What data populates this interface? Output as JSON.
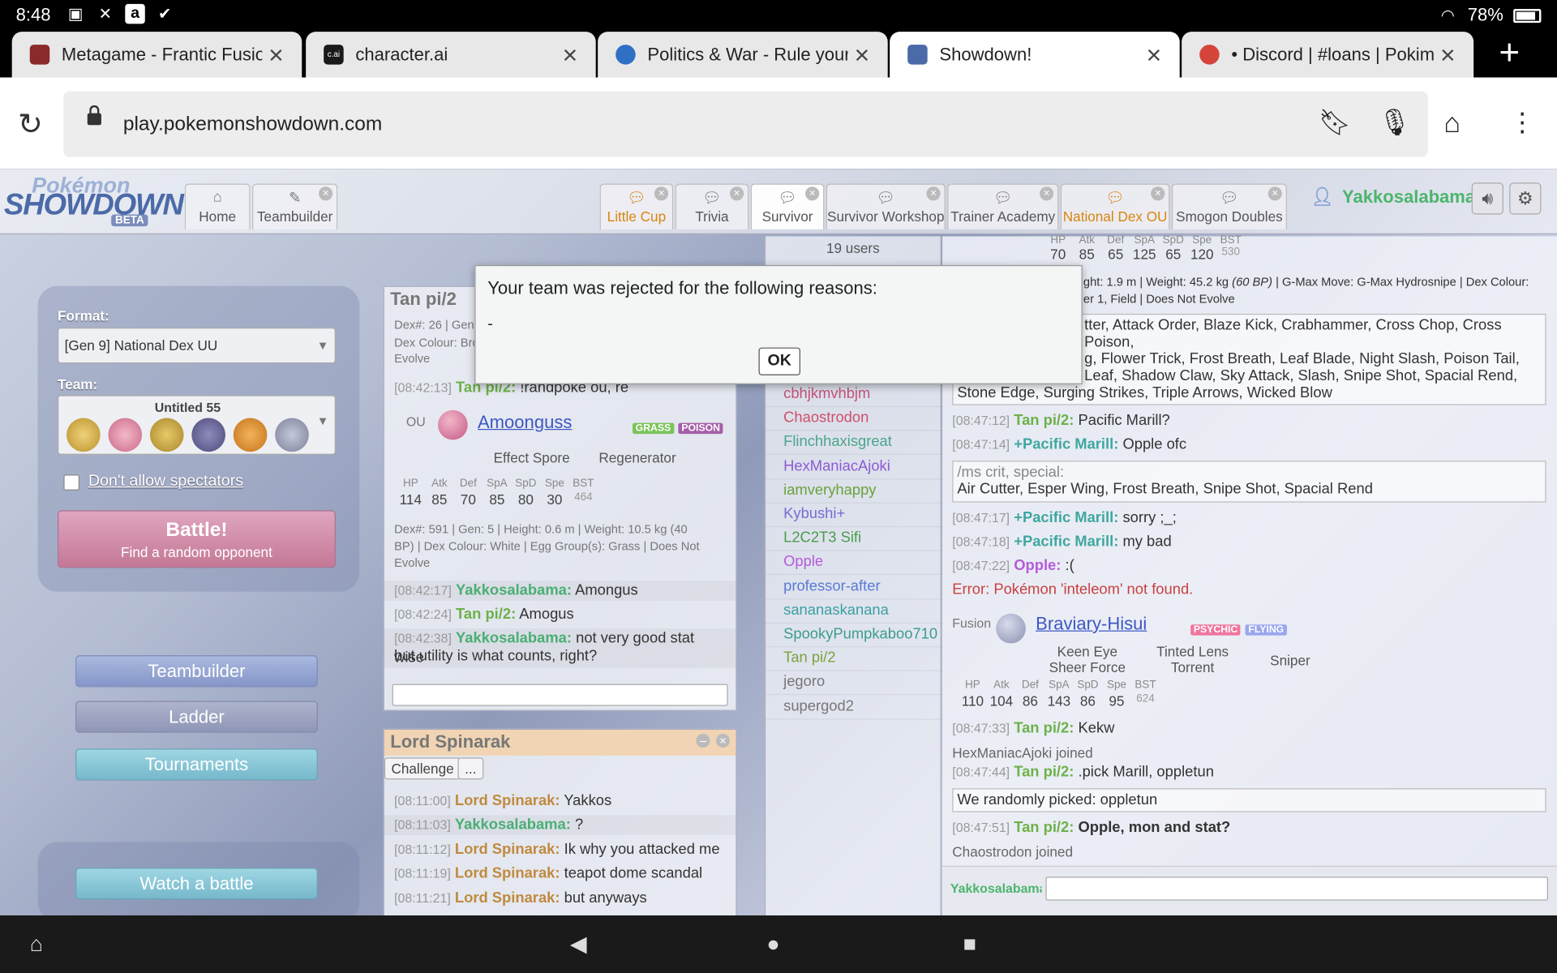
{
  "status": {
    "time": "8:48",
    "battery": "78%",
    "icons": [
      "image-icon",
      "x-icon",
      "amazon-icon",
      "check-icon"
    ]
  },
  "browser": {
    "tabs": [
      {
        "title": "Metagame - Frantic Fusions",
        "favicon_color": "#8b2a2a"
      },
      {
        "title": "character.ai",
        "favicon_color": "#1a1a1a",
        "favicon_text": "c.ai"
      },
      {
        "title": "Politics & War - Rule your ow",
        "favicon_color": "#2f6fc4"
      },
      {
        "title": "Showdown!",
        "favicon_color": "#4b6aa8",
        "active": true
      },
      {
        "title": "• Discord | #loans | Pokimans",
        "favicon_color": "#d4443a"
      }
    ],
    "url": "play.pokemonshowdown.com"
  },
  "header": {
    "logo_top": "Pokémon",
    "logo_main": "SHOWDOWN",
    "logo_beta": "BETA",
    "home": "Home",
    "teambuilder": "Teambuilder",
    "rooms": [
      {
        "label": "Little Cup",
        "highlight": true
      },
      {
        "label": "Trivia"
      },
      {
        "label": "Survivor"
      },
      {
        "label": "Survivor Workshop"
      },
      {
        "label": "Trainer Academy"
      },
      {
        "label": "National Dex OU",
        "highlight": true
      },
      {
        "label": "Smogon Doubles"
      }
    ],
    "username": "Yakkosalabama"
  },
  "menu": {
    "format_label": "Format:",
    "format_value": "[Gen 9] National Dex UU",
    "team_label": "Team:",
    "team_name": "Untitled 55",
    "team_colors": [
      "#d9b24a",
      "#e28aa8",
      "#c9a640",
      "#6c6a9a",
      "#e3953a",
      "#9b9fb7"
    ],
    "spectators": "Don't allow spectators",
    "battle_title": "Battle!",
    "battle_sub": "Find a random opponent",
    "teambuilder": "Teambuilder",
    "ladder": "Ladder",
    "tournaments": "Tournaments",
    "watch": "Watch a battle"
  },
  "tan_panel": {
    "title": "Tan pi/2",
    "top_line1": "Dex#: 26 | Gen",
    "top_line2": "Dex Colour: Bro",
    "top_line3": "Evolve",
    "cmd_ts": "[08:42:13]",
    "cmd_name": "Tan pi/2:",
    "cmd_text": "!randpoke ou, re",
    "tier": "OU",
    "mon_name": "Amoonguss",
    "types": [
      "GRASS",
      "POISON"
    ],
    "ability1": "Effect Spore",
    "ability2": "Regenerator",
    "stat_labels": [
      "HP",
      "Atk",
      "Def",
      "SpA",
      "SpD",
      "Spe",
      "BST"
    ],
    "stat_values": [
      "114",
      "85",
      "70",
      "85",
      "80",
      "30",
      "464"
    ],
    "info1": "Dex#: 591 | Gen: 5 | Height: 0.6 m | Weight: 10.5 kg  (40",
    "info2": "BP)  | Dex Colour: White | Egg Group(s): Grass | Does Not",
    "info3": "Evolve",
    "msgs": [
      {
        "ts": "[08:42:17]",
        "name": "Yakkosalabama:",
        "text": "Amongus"
      },
      {
        "ts": "[08:42:24]",
        "name": "Tan pi/2:",
        "text": "Amogus"
      },
      {
        "ts": "[08:42:38]",
        "name": "Yakkosalabama:",
        "text": "not very good stat wise"
      }
    ],
    "msg_cont": "but utility is what counts, right?"
  },
  "lord_panel": {
    "title": "Lord Spinarak",
    "challenge": "Challenge",
    "more": "...",
    "msgs": [
      {
        "ts": "[08:11:00]",
        "name": "Lord Spinarak:",
        "text": "Yakkos"
      },
      {
        "ts": "[08:11:03]",
        "name": "Yakkosalabama:",
        "text": "?"
      },
      {
        "ts": "[08:11:12]",
        "name": "Lord Spinarak:",
        "text": "Ik why you attacked me"
      },
      {
        "ts": "[08:11:19]",
        "name": "Lord Spinarak:",
        "text": "teapot dome scandal"
      },
      {
        "ts": "[08:11:21]",
        "name": "Lord Spinarak:",
        "text": "but anyways"
      }
    ]
  },
  "userlist": {
    "count": "19 users",
    "users": [
      {
        "name": "cbhjkmvhbjm",
        "color": "#c4527a"
      },
      {
        "name": "Chaostrodon",
        "color": "#d04e6a"
      },
      {
        "name": "Flinchhaxisgreat",
        "color": "#4aa68a"
      },
      {
        "name": "HexManiacAjoki",
        "color": "#8c5bd4"
      },
      {
        "name": "iamveryhappy",
        "color": "#6aa23a"
      },
      {
        "name": "Kybushi+",
        "color": "#7a6ad0"
      },
      {
        "name": "L2C2T3 Sifi",
        "color": "#4a9c4a"
      },
      {
        "name": "Opple",
        "color": "#b45cd8"
      },
      {
        "name": "professor-after",
        "color": "#5a7ad4"
      },
      {
        "name": "sananaskanana",
        "color": "#3aa0a0"
      },
      {
        "name": "SpookyPumpkaboo710",
        "color": "#3c9c8c"
      },
      {
        "name": "Tan pi/2",
        "color": "#7aa23a"
      },
      {
        "name": "jegoro",
        "color": "#777777"
      },
      {
        "name": "supergod2",
        "color": "#777777"
      }
    ]
  },
  "right_chat": {
    "top_stat_labels": [
      "HP",
      "Atk",
      "Def",
      "SpA",
      "SpD",
      "Spe",
      "BST"
    ],
    "top_stat_values": [
      "70",
      "85",
      "65",
      "125",
      "65",
      "120",
      "530"
    ],
    "top_info1a": "ght: 1.9 m | Weight: 45.2 kg",
    "top_info1b": "(60 BP)",
    "top_info1c": "| G-Max Move: G-Max Hydrosnipe | Dex Colour:",
    "top_info2": "er 1, Field | Does Not Evolve",
    "crit_moves1": "tter, Attack Order, Blaze Kick, Crabhammer, Cross Chop, Cross Poison,",
    "crit_moves2": "g, Flower Trick, Frost Breath, Leaf Blade, Night Slash, Poison Tail,",
    "crit_moves3": "Leaf, Shadow Claw, Sky Attack, Slash, Snipe Shot, Spacial Rend,",
    "crit_moves4": "Stone Edge, Surging Strikes, Triple Arrows, Wicked Blow",
    "msgs1": [
      {
        "ts": "[08:47:12]",
        "name": "Tan pi/2:",
        "text": "Pacific Marill?",
        "cls": "g"
      },
      {
        "ts": "[08:47:14]",
        "name": "+Pacific Marill:",
        "text": "Opple ofc",
        "cls": "pm"
      }
    ],
    "special_cmd": "/ms crit, special:",
    "special_moves": "Air Cutter, Esper Wing, Frost Breath, Snipe Shot, Spacial Rend",
    "msgs2": [
      {
        "ts": "[08:47:17]",
        "name": "+Pacific Marill:",
        "text": "sorry ;_;",
        "cls": "pm"
      },
      {
        "ts": "[08:47:18]",
        "name": "+Pacific Marill:",
        "text": "my bad",
        "cls": "pm"
      },
      {
        "ts": "[08:47:22]",
        "name": "Opple:",
        "text": ":(",
        "cls": "pp"
      }
    ],
    "error": "Error: Pokémon 'inteleom' not found.",
    "fusion_label": "Fusion",
    "fusion_name": "Braviary-Hisui",
    "fusion_types": [
      "PSYCHIC",
      "FLYING"
    ],
    "fusion_ab1a": "Keen Eye",
    "fusion_ab1b": "Sheer Force",
    "fusion_ab2a": "Tinted Lens",
    "fusion_ab2b": "Torrent",
    "fusion_ab3": "Sniper",
    "fusion_stat_labels": [
      "HP",
      "Atk",
      "Def",
      "SpA",
      "SpD",
      "Spe",
      "BST"
    ],
    "fusion_stat_values": [
      "110",
      "104",
      "86",
      "143",
      "86",
      "95",
      "624"
    ],
    "kekw": {
      "ts": "[08:47:33]",
      "name": "Tan pi/2:",
      "text": "Kekw"
    },
    "joined1": "HexManiacAjoki joined",
    "pick": {
      "ts": "[08:47:44]",
      "name": "Tan pi/2:",
      "text": ".pick Marill, oppletun"
    },
    "picked": "We randomly picked:  oppletun",
    "last": {
      "ts": "[08:47:51]",
      "name": "Tan pi/2:",
      "text": "Opple, mon and stat?"
    },
    "joined2": "Chaostrodon joined",
    "input_name": "Yakkosalabama"
  },
  "modal": {
    "message": "Your team was rejected for the following reasons:",
    "detail": "-",
    "ok": "OK"
  }
}
